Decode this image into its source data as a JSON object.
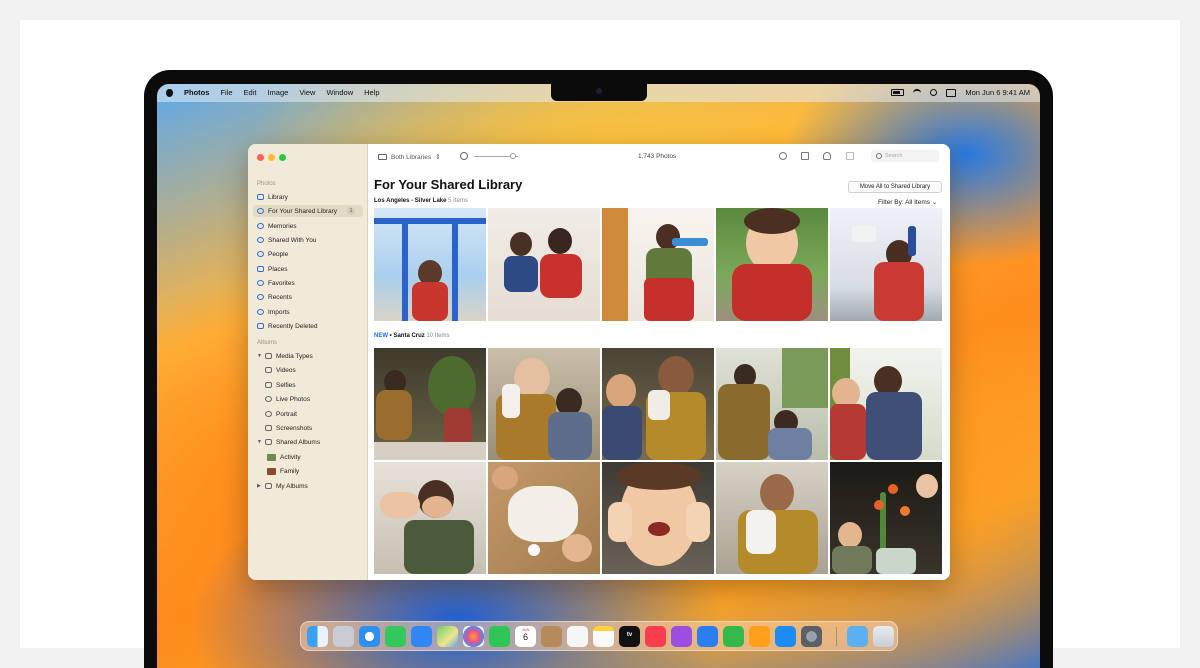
{
  "menubar": {
    "app_name": "Photos",
    "menus": [
      "File",
      "Edit",
      "Image",
      "View",
      "Window",
      "Help"
    ],
    "datetime": "Mon Jun 6  9:41 AM"
  },
  "sidebar": {
    "photos_section": "Photos",
    "items": [
      {
        "label": "Library",
        "icon": "library-icon"
      },
      {
        "label": "For Your Shared Library",
        "icon": "shared-people-icon",
        "badge": "1",
        "selected": true
      },
      {
        "label": "Memories",
        "icon": "memories-icon"
      },
      {
        "label": "Shared With You",
        "icon": "shared-with-you-icon"
      },
      {
        "label": "People",
        "icon": "people-icon"
      },
      {
        "label": "Places",
        "icon": "places-icon"
      },
      {
        "label": "Favorites",
        "icon": "heart-icon"
      },
      {
        "label": "Recents",
        "icon": "clock-icon"
      },
      {
        "label": "Imports",
        "icon": "import-icon"
      },
      {
        "label": "Recently Deleted",
        "icon": "trash-icon"
      }
    ],
    "albums_section": "Albums",
    "media_types": "Media Types",
    "media_items": [
      {
        "label": "Videos",
        "icon": "video-icon"
      },
      {
        "label": "Selfies",
        "icon": "selfie-icon"
      },
      {
        "label": "Live Photos",
        "icon": "live-photo-icon"
      },
      {
        "label": "Portrait",
        "icon": "portrait-icon"
      },
      {
        "label": "Screenshots",
        "icon": "screenshot-icon"
      }
    ],
    "shared_albums": "Shared Albums",
    "shared_items": [
      {
        "label": "Activity",
        "icon": "activity-thumb"
      },
      {
        "label": "Family",
        "icon": "family-thumb"
      }
    ],
    "my_albums": "My Albums"
  },
  "toolbar": {
    "library_selector": "Both Libraries",
    "photo_count": "1,743 Photos",
    "search_placeholder": "Search"
  },
  "main": {
    "title": "For Your Shared Library",
    "move_all_button": "Move All to Shared Library",
    "filter_label": "Filter By: All Items",
    "groups": [
      {
        "name": "Los Angeles - Silver Lake",
        "count": "5 Items",
        "new_label": "",
        "photo_count": 5
      },
      {
        "name": "Santa Cruz",
        "count": "10 Items",
        "new_label": "NEW",
        "separator": "•",
        "photo_count": 10
      }
    ]
  },
  "dock": {
    "calendar_month": "JUN",
    "calendar_day": "6",
    "tv_label": "tv",
    "apps": [
      "finder-icon",
      "launchpad-icon",
      "safari-icon",
      "messages-icon",
      "mail-icon",
      "maps-icon",
      "photos-icon",
      "facetime-icon",
      "calendar-icon",
      "contacts-icon",
      "reminders-icon",
      "notes-icon",
      "tv-icon",
      "music-icon",
      "podcasts-icon",
      "keynote-icon",
      "numbers-icon",
      "pages-icon",
      "app-store-icon",
      "system-settings-icon",
      "downloads-folder-icon",
      "trash-icon"
    ]
  },
  "colors": {
    "accent": "#1e6ff0",
    "sidebar_bg": "#f1ead9",
    "selection_bg": "#e3dac5"
  }
}
